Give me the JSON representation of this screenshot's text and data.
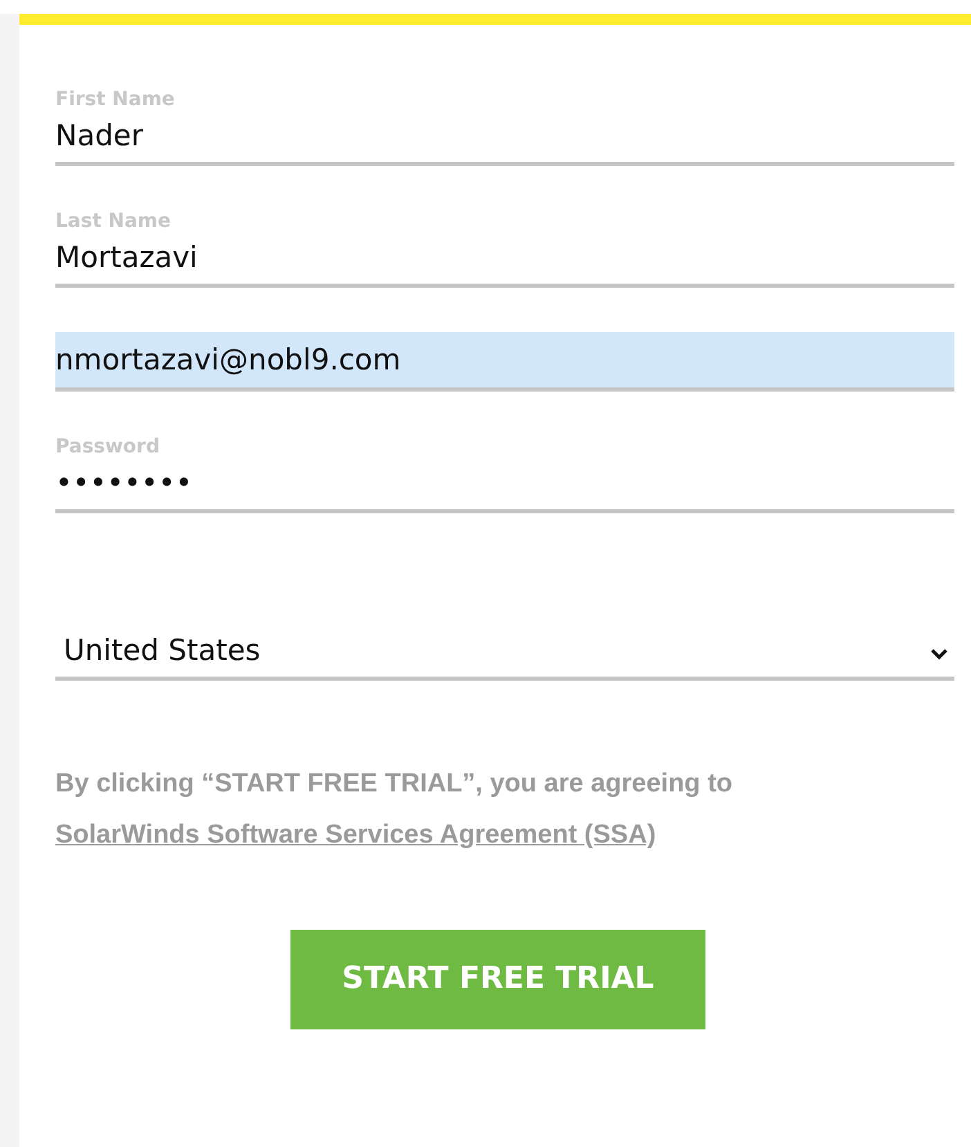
{
  "fields": [
    {
      "kind": "text",
      "label": "First Name",
      "value": "Nader",
      "autofilled": false
    },
    {
      "kind": "text",
      "label": "Last Name",
      "value": "Mortazavi",
      "autofilled": false
    },
    {
      "kind": "text",
      "value": "nmortazavi@nobl9.com",
      "autofilled": true
    },
    {
      "kind": "text",
      "label": "Password",
      "value": "••••••••",
      "autofilled": false
    },
    {
      "kind": "select",
      "value": "United States",
      "autofilled": false
    }
  ],
  "agreement": {
    "text": "By clicking “START FREE TRIAL”, you are agreeing to",
    "link": "SolarWinds Software Services Agreement (SSA)"
  },
  "submit_button": "START FREE TRIAL"
}
